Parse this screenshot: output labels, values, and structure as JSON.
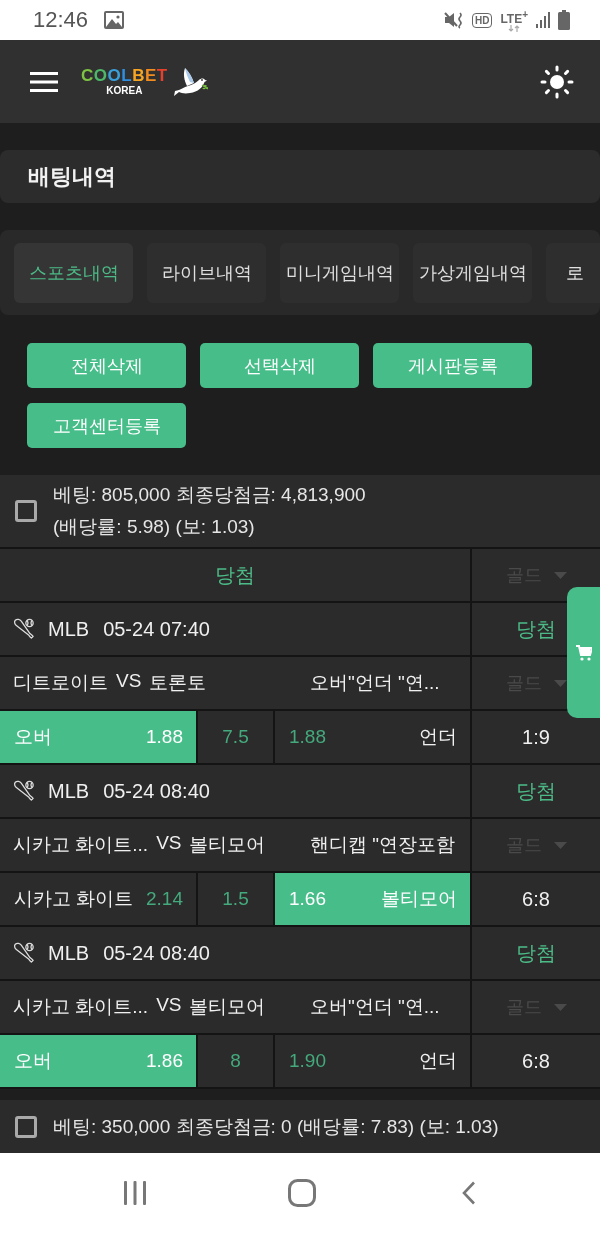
{
  "status_bar": {
    "time": "12:46",
    "hd": "HD",
    "network": "LTE$^{+}$"
  },
  "header": {
    "logo": "COOLBET",
    "logo_sub": "KOREA"
  },
  "page_title": "배팅내역",
  "tabs": [
    {
      "label": "스포츠내역",
      "selected": true
    },
    {
      "label": "라이브내역",
      "selected": false
    },
    {
      "label": "미니게임내역",
      "selected": false
    },
    {
      "label": "가상게임내역",
      "selected": false
    },
    {
      "label": "로",
      "selected": false
    }
  ],
  "actions": [
    "전체삭제",
    "선택삭제",
    "게시판등록",
    "고객센터등록"
  ],
  "bets": [
    {
      "checked": false,
      "summary": "베팅: 805,000 최종당첨금: 4,813,900\n(배당률: 5.98) (보: 1.03)",
      "result": "당첨",
      "grade": {
        "value": "골드",
        "disabled": true
      },
      "games": [
        {
          "league": "MLB",
          "time": "05-24 07:40",
          "result": "당첨",
          "home": "디트로이트",
          "vs": "VS",
          "away": "토론토",
          "market": "오버\"언더 \"연...",
          "grade": {
            "value": "골드",
            "disabled": true
          },
          "picks": [
            {
              "label": "오버",
              "odds": "1.88",
              "selected": true
            },
            {
              "label": "언더",
              "odds": "1.88",
              "selected": false
            }
          ],
          "line": "7.5",
          "score": "1:9"
        },
        {
          "league": "MLB",
          "time": "05-24 08:40",
          "result": "당첨",
          "home": "시카고 화이트...",
          "vs": "VS",
          "away": "볼티모어",
          "market": "핸디캡 \"연장포함",
          "grade": {
            "value": "골드",
            "disabled": true
          },
          "picks": [
            {
              "label": "시카고 화이트",
              "odds": "2.14",
              "selected": false
            },
            {
              "label": "볼티모어",
              "odds": "1.66",
              "selected": true
            }
          ],
          "line": "1.5",
          "score": "6:8"
        },
        {
          "league": "MLB",
          "time": "05-24 08:40",
          "result": "당첨",
          "home": "시카고 화이트...",
          "vs": "VS",
          "away": "볼티모어",
          "market": "오버\"언더 \"연...",
          "grade": {
            "value": "골드",
            "disabled": true
          },
          "picks": [
            {
              "label": "오버",
              "odds": "1.86",
              "selected": true
            },
            {
              "label": "언더",
              "odds": "1.90",
              "selected": false
            }
          ],
          "line": "8",
          "score": "6:8"
        }
      ]
    },
    {
      "checked": false,
      "summary": "베팅: 350,000 최종당첨금: 0 (배당률: 7.83) (보: 1.03)"
    }
  ]
}
